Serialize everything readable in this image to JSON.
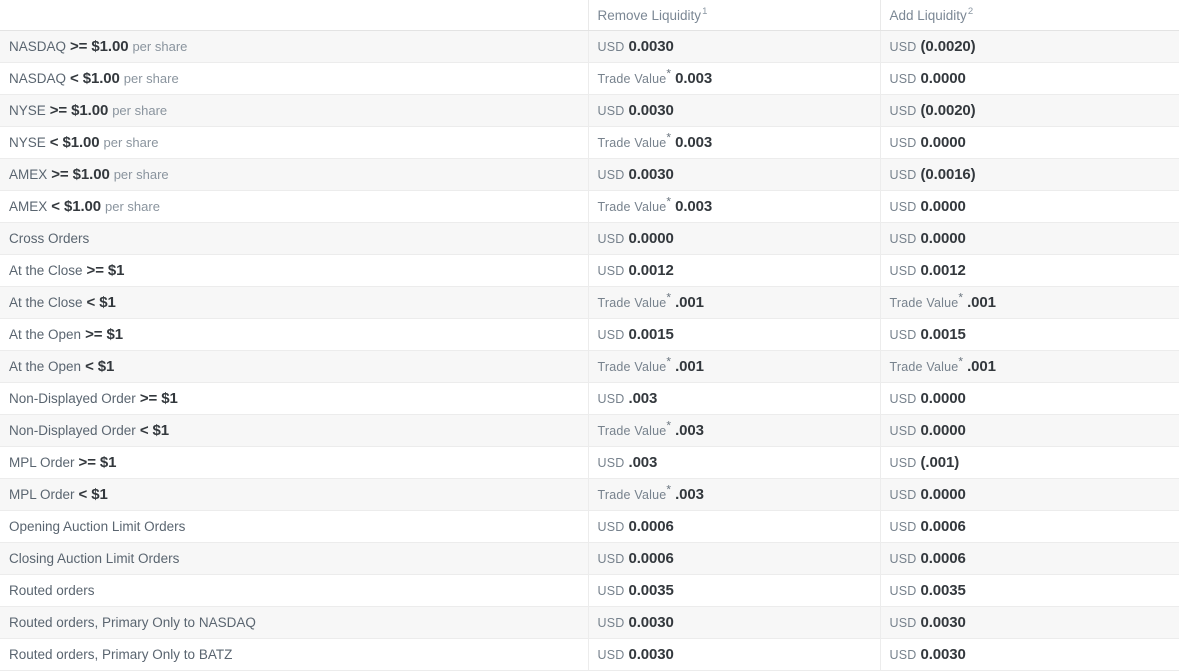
{
  "table": {
    "headers": {
      "description": "",
      "remove_liquidity": "Remove Liquidity",
      "remove_liquidity_footnote": "1",
      "add_liquidity": "Add Liquidity",
      "add_liquidity_footnote": "2"
    },
    "rows": [
      {
        "desc_label": "NASDAQ",
        "desc_strong": ">= $1.00",
        "desc_muted": "per share",
        "remove_unit": "USD",
        "remove_value": "0.0030",
        "add_unit": "USD",
        "add_value": "(0.0020)"
      },
      {
        "desc_label": "NASDAQ",
        "desc_strong": "< $1.00",
        "desc_muted": "per share",
        "remove_unit": "Trade Value",
        "remove_star": "*",
        "remove_value": "0.003",
        "add_unit": "USD",
        "add_value": "0.0000"
      },
      {
        "desc_label": "NYSE",
        "desc_strong": ">= $1.00",
        "desc_muted": "per share",
        "remove_unit": "USD",
        "remove_value": "0.0030",
        "add_unit": "USD",
        "add_value": "(0.0020)"
      },
      {
        "desc_label": "NYSE",
        "desc_strong": "< $1.00",
        "desc_muted": "per share",
        "remove_unit": "Trade Value",
        "remove_star": "*",
        "remove_value": "0.003",
        "add_unit": "USD",
        "add_value": "0.0000"
      },
      {
        "desc_label": "AMEX",
        "desc_strong": ">= $1.00",
        "desc_muted": "per share",
        "remove_unit": "USD",
        "remove_value": "0.0030",
        "add_unit": "USD",
        "add_value": "(0.0016)"
      },
      {
        "desc_label": "AMEX",
        "desc_strong": "< $1.00",
        "desc_muted": "per share",
        "remove_unit": "Trade Value",
        "remove_star": "*",
        "remove_value": "0.003",
        "add_unit": "USD",
        "add_value": "0.0000"
      },
      {
        "desc_label": "Cross Orders",
        "desc_strong": "",
        "desc_muted": "",
        "remove_unit": "USD",
        "remove_value": "0.0000",
        "add_unit": "USD",
        "add_value": "0.0000"
      },
      {
        "desc_label": "At the Close",
        "desc_strong": ">= $1",
        "desc_muted": "",
        "remove_unit": "USD",
        "remove_value": "0.0012",
        "add_unit": "USD",
        "add_value": "0.0012"
      },
      {
        "desc_label": "At the Close",
        "desc_strong": "< $1",
        "desc_muted": "",
        "remove_unit": "Trade Value",
        "remove_star": "*",
        "remove_value": ".001",
        "add_unit": "Trade Value",
        "add_star": "*",
        "add_value": ".001"
      },
      {
        "desc_label": "At the Open",
        "desc_strong": ">= $1",
        "desc_muted": "",
        "remove_unit": "USD",
        "remove_value": "0.0015",
        "add_unit": "USD",
        "add_value": "0.0015"
      },
      {
        "desc_label": "At the Open",
        "desc_strong": "< $1",
        "desc_muted": "",
        "remove_unit": "Trade Value",
        "remove_star": "*",
        "remove_value": ".001",
        "add_unit": "Trade Value",
        "add_star": "*",
        "add_value": ".001"
      },
      {
        "desc_label": "Non-Displayed Order",
        "desc_strong": ">= $1",
        "desc_muted": "",
        "remove_unit": "USD",
        "remove_value": ".003",
        "add_unit": "USD",
        "add_value": "0.0000"
      },
      {
        "desc_label": "Non-Displayed Order",
        "desc_strong": "< $1",
        "desc_muted": "",
        "remove_unit": "Trade Value",
        "remove_star": "*",
        "remove_value": ".003",
        "add_unit": "USD",
        "add_value": "0.0000"
      },
      {
        "desc_label": "MPL Order",
        "desc_strong": ">= $1",
        "desc_muted": "",
        "remove_unit": "USD",
        "remove_value": ".003",
        "add_unit": "USD",
        "add_value": "(.001)"
      },
      {
        "desc_label": "MPL Order",
        "desc_strong": "< $1",
        "desc_muted": "",
        "remove_unit": "Trade Value",
        "remove_star": "*",
        "remove_value": ".003",
        "add_unit": "USD",
        "add_value": "0.0000"
      },
      {
        "desc_label": "Opening Auction Limit Orders",
        "desc_strong": "",
        "desc_muted": "",
        "remove_unit": "USD",
        "remove_value": "0.0006",
        "add_unit": "USD",
        "add_value": "0.0006"
      },
      {
        "desc_label": "Closing Auction Limit Orders",
        "desc_strong": "",
        "desc_muted": "",
        "remove_unit": "USD",
        "remove_value": "0.0006",
        "add_unit": "USD",
        "add_value": "0.0006"
      },
      {
        "desc_label": "Routed orders",
        "desc_strong": "",
        "desc_muted": "",
        "remove_unit": "USD",
        "remove_value": "0.0035",
        "add_unit": "USD",
        "add_value": "0.0035"
      },
      {
        "desc_label": "Routed orders, Primary Only to NASDAQ",
        "desc_strong": "",
        "desc_muted": "",
        "remove_unit": "USD",
        "remove_value": "0.0030",
        "add_unit": "USD",
        "add_value": "0.0030"
      },
      {
        "desc_label": "Routed orders, Primary Only to BATZ",
        "desc_strong": "",
        "desc_muted": "",
        "remove_unit": "USD",
        "remove_value": "0.0030",
        "add_unit": "USD",
        "add_value": "0.0030"
      }
    ]
  },
  "colors": {
    "row_stripe": "#f7f7f7",
    "row_plain": "#ffffff",
    "border": "#ececec",
    "label_text": "#5a6570",
    "strong_text": "#33383d",
    "muted_text": "#8a949e",
    "header_text": "#7b8794"
  }
}
